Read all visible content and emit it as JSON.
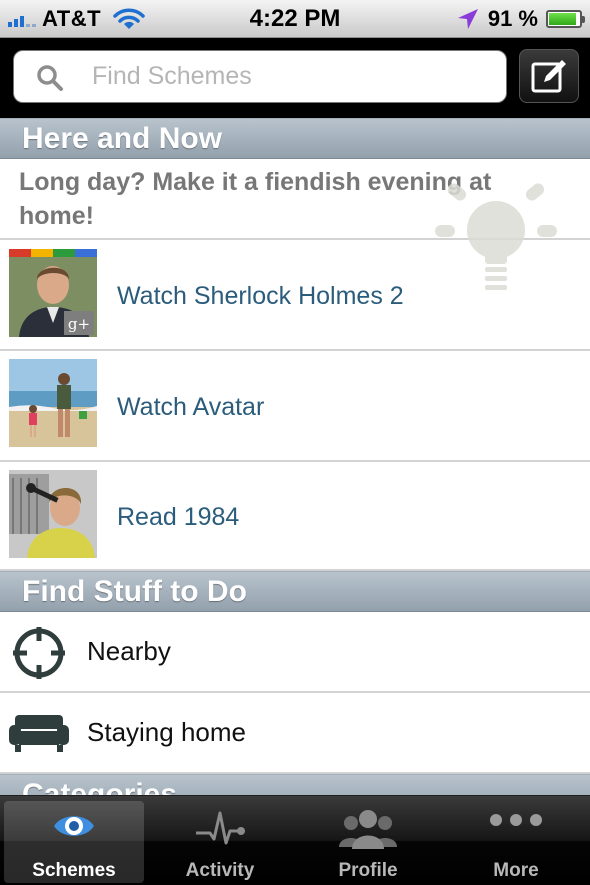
{
  "status_bar": {
    "carrier": "AT&T",
    "time": "4:22 PM",
    "battery_percent": "91 %",
    "battery_level": 0.91
  },
  "search": {
    "placeholder": "Find Schemes"
  },
  "sections": {
    "here_and_now": "Here and Now",
    "find_stuff": "Find Stuff to Do",
    "categories": "Categories"
  },
  "promo": {
    "text": "Long day? Make it a fiendish evening at home!"
  },
  "schemes": [
    {
      "label": "Watch Sherlock Holmes 2"
    },
    {
      "label": "Watch Avatar"
    },
    {
      "label": "Read 1984"
    }
  ],
  "options": [
    {
      "label": "Nearby",
      "icon": "crosshair-icon"
    },
    {
      "label": "Staying home",
      "icon": "sofa-icon"
    }
  ],
  "tabs": [
    {
      "label": "Schemes",
      "icon": "eye-icon",
      "active": true
    },
    {
      "label": "Activity",
      "icon": "pulse-icon",
      "active": false
    },
    {
      "label": "Profile",
      "icon": "people-icon",
      "active": false
    },
    {
      "label": "More",
      "icon": "more-dots-icon",
      "active": false
    }
  ],
  "colors": {
    "section_header": "#a6b2bd",
    "link_text": "#2b5c7c",
    "location_arrow": "#8a3bd8",
    "battery_green": "#3cc01f",
    "active_tab_icon": "#3f8fe0"
  }
}
